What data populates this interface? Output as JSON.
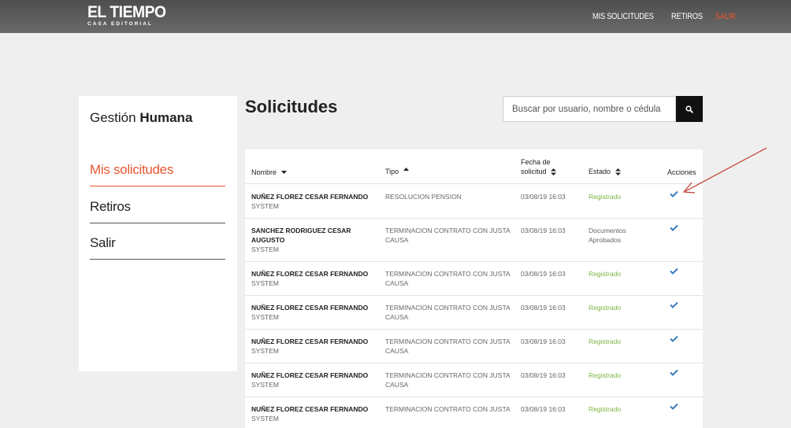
{
  "header": {
    "logo_main": "EL TIEMPO",
    "logo_sub": "CASA EDITORIAL",
    "nav": [
      "MIS SOLICITUDES",
      "RETIROS",
      "SALIR"
    ]
  },
  "sidebar": {
    "title_light": "Gestión",
    "title_bold": "Humana",
    "items": [
      {
        "label": "Mis solicitudes",
        "active": true
      },
      {
        "label": "Retiros",
        "active": false
      },
      {
        "label": "Salir",
        "active": false
      }
    ]
  },
  "main": {
    "title": "Solicitudes",
    "search_placeholder": "Buscar por usuario, nombre o cédula"
  },
  "table": {
    "columns": {
      "nombre": "Nombre",
      "tipo": "Tipo",
      "fecha_line1": "Fecha de",
      "fecha_line2": "solicitud",
      "estado": "Estado",
      "acciones": "Acciones"
    },
    "rows": [
      {
        "name": "NUÑEZ FLOREZ CESAR FERNANDO",
        "user": "SYSTEM",
        "tipo": "RESOLUCION PENSION",
        "fecha": "03/08/19 16:03",
        "estado": "Registrado"
      },
      {
        "name": "SANCHEZ RODRIGUEZ CESAR AUGUSTO",
        "user": "SYSTEM",
        "tipo": "TERMINACION CONTRATO CON JUSTA CAUSA",
        "fecha": "03/08/19 16:03",
        "estado": "Documentos Aprobados"
      },
      {
        "name": "NUÑEZ FLOREZ CESAR FERNANDO",
        "user": "SYSTEM",
        "tipo": "TERMINACION CONTRATO CON JUSTA CAUSA",
        "fecha": "03/08/19 16:03",
        "estado": "Registrado"
      },
      {
        "name": "NUÑEZ FLOREZ CESAR FERNANDO",
        "user": "SYSTEM",
        "tipo": "TERMINACION CONTRATO CON JUSTA CAUSA",
        "fecha": "03/08/19 16:03",
        "estado": "Registrado"
      },
      {
        "name": "NUÑEZ FLOREZ CESAR FERNANDO",
        "user": "SYSTEM",
        "tipo": "TERMINACION CONTRATO CON JUSTA CAUSA",
        "fecha": "03/08/19 16:03",
        "estado": "Registrado"
      },
      {
        "name": "NUÑEZ FLOREZ CESAR FERNANDO",
        "user": "SYSTEM",
        "tipo": "TERMINACION CONTRATO CON JUSTA CAUSA",
        "fecha": "03/08/19 16:03",
        "estado": "Registrado"
      },
      {
        "name": "NUÑEZ FLOREZ CESAR FERNANDO",
        "user": "SYSTEM",
        "tipo": "TERMINACION CONTRATO CON JUSTA",
        "fecha": "03/08/19 16:03",
        "estado": "Registrado"
      }
    ]
  },
  "colors": {
    "accent": "#e8572f",
    "status_registered": "#7cb342",
    "check": "#3a7bbf",
    "annotation_arrow": "#c0392b"
  },
  "icons": {
    "search": "search-icon",
    "action": "check-icon"
  }
}
